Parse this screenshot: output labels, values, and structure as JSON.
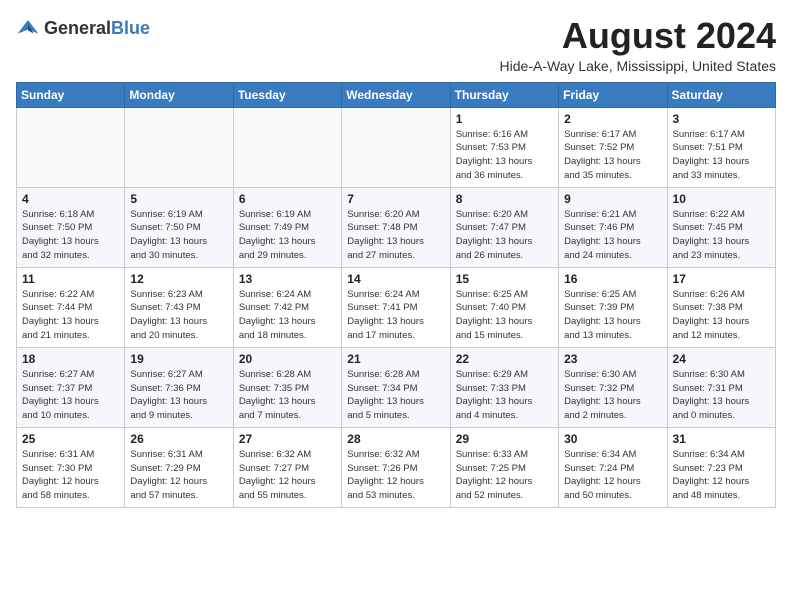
{
  "logo": {
    "text_general": "General",
    "text_blue": "Blue"
  },
  "header": {
    "month_year": "August 2024",
    "location": "Hide-A-Way Lake, Mississippi, United States"
  },
  "weekdays": [
    "Sunday",
    "Monday",
    "Tuesday",
    "Wednesday",
    "Thursday",
    "Friday",
    "Saturday"
  ],
  "weeks": [
    [
      {
        "day": "",
        "info": ""
      },
      {
        "day": "",
        "info": ""
      },
      {
        "day": "",
        "info": ""
      },
      {
        "day": "",
        "info": ""
      },
      {
        "day": "1",
        "info": "Sunrise: 6:16 AM\nSunset: 7:53 PM\nDaylight: 13 hours\nand 36 minutes."
      },
      {
        "day": "2",
        "info": "Sunrise: 6:17 AM\nSunset: 7:52 PM\nDaylight: 13 hours\nand 35 minutes."
      },
      {
        "day": "3",
        "info": "Sunrise: 6:17 AM\nSunset: 7:51 PM\nDaylight: 13 hours\nand 33 minutes."
      }
    ],
    [
      {
        "day": "4",
        "info": "Sunrise: 6:18 AM\nSunset: 7:50 PM\nDaylight: 13 hours\nand 32 minutes."
      },
      {
        "day": "5",
        "info": "Sunrise: 6:19 AM\nSunset: 7:50 PM\nDaylight: 13 hours\nand 30 minutes."
      },
      {
        "day": "6",
        "info": "Sunrise: 6:19 AM\nSunset: 7:49 PM\nDaylight: 13 hours\nand 29 minutes."
      },
      {
        "day": "7",
        "info": "Sunrise: 6:20 AM\nSunset: 7:48 PM\nDaylight: 13 hours\nand 27 minutes."
      },
      {
        "day": "8",
        "info": "Sunrise: 6:20 AM\nSunset: 7:47 PM\nDaylight: 13 hours\nand 26 minutes."
      },
      {
        "day": "9",
        "info": "Sunrise: 6:21 AM\nSunset: 7:46 PM\nDaylight: 13 hours\nand 24 minutes."
      },
      {
        "day": "10",
        "info": "Sunrise: 6:22 AM\nSunset: 7:45 PM\nDaylight: 13 hours\nand 23 minutes."
      }
    ],
    [
      {
        "day": "11",
        "info": "Sunrise: 6:22 AM\nSunset: 7:44 PM\nDaylight: 13 hours\nand 21 minutes."
      },
      {
        "day": "12",
        "info": "Sunrise: 6:23 AM\nSunset: 7:43 PM\nDaylight: 13 hours\nand 20 minutes."
      },
      {
        "day": "13",
        "info": "Sunrise: 6:24 AM\nSunset: 7:42 PM\nDaylight: 13 hours\nand 18 minutes."
      },
      {
        "day": "14",
        "info": "Sunrise: 6:24 AM\nSunset: 7:41 PM\nDaylight: 13 hours\nand 17 minutes."
      },
      {
        "day": "15",
        "info": "Sunrise: 6:25 AM\nSunset: 7:40 PM\nDaylight: 13 hours\nand 15 minutes."
      },
      {
        "day": "16",
        "info": "Sunrise: 6:25 AM\nSunset: 7:39 PM\nDaylight: 13 hours\nand 13 minutes."
      },
      {
        "day": "17",
        "info": "Sunrise: 6:26 AM\nSunset: 7:38 PM\nDaylight: 13 hours\nand 12 minutes."
      }
    ],
    [
      {
        "day": "18",
        "info": "Sunrise: 6:27 AM\nSunset: 7:37 PM\nDaylight: 13 hours\nand 10 minutes."
      },
      {
        "day": "19",
        "info": "Sunrise: 6:27 AM\nSunset: 7:36 PM\nDaylight: 13 hours\nand 9 minutes."
      },
      {
        "day": "20",
        "info": "Sunrise: 6:28 AM\nSunset: 7:35 PM\nDaylight: 13 hours\nand 7 minutes."
      },
      {
        "day": "21",
        "info": "Sunrise: 6:28 AM\nSunset: 7:34 PM\nDaylight: 13 hours\nand 5 minutes."
      },
      {
        "day": "22",
        "info": "Sunrise: 6:29 AM\nSunset: 7:33 PM\nDaylight: 13 hours\nand 4 minutes."
      },
      {
        "day": "23",
        "info": "Sunrise: 6:30 AM\nSunset: 7:32 PM\nDaylight: 13 hours\nand 2 minutes."
      },
      {
        "day": "24",
        "info": "Sunrise: 6:30 AM\nSunset: 7:31 PM\nDaylight: 13 hours\nand 0 minutes."
      }
    ],
    [
      {
        "day": "25",
        "info": "Sunrise: 6:31 AM\nSunset: 7:30 PM\nDaylight: 12 hours\nand 58 minutes."
      },
      {
        "day": "26",
        "info": "Sunrise: 6:31 AM\nSunset: 7:29 PM\nDaylight: 12 hours\nand 57 minutes."
      },
      {
        "day": "27",
        "info": "Sunrise: 6:32 AM\nSunset: 7:27 PM\nDaylight: 12 hours\nand 55 minutes."
      },
      {
        "day": "28",
        "info": "Sunrise: 6:32 AM\nSunset: 7:26 PM\nDaylight: 12 hours\nand 53 minutes."
      },
      {
        "day": "29",
        "info": "Sunrise: 6:33 AM\nSunset: 7:25 PM\nDaylight: 12 hours\nand 52 minutes."
      },
      {
        "day": "30",
        "info": "Sunrise: 6:34 AM\nSunset: 7:24 PM\nDaylight: 12 hours\nand 50 minutes."
      },
      {
        "day": "31",
        "info": "Sunrise: 6:34 AM\nSunset: 7:23 PM\nDaylight: 12 hours\nand 48 minutes."
      }
    ]
  ]
}
